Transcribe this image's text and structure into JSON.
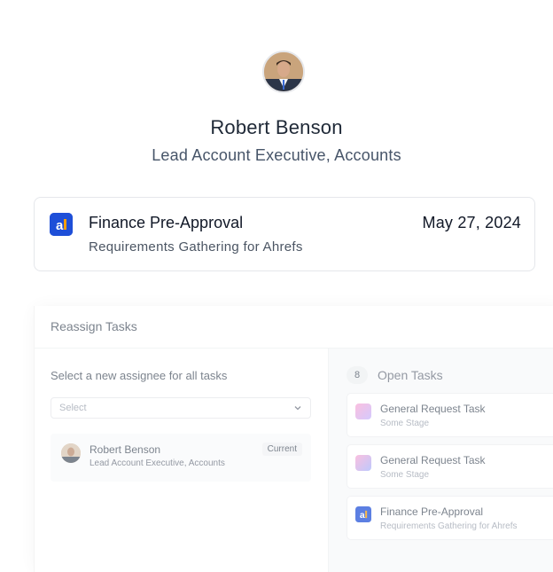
{
  "profile": {
    "name": "Robert Benson",
    "role": "Lead Account Executive, Accounts"
  },
  "deal": {
    "title": "Finance Pre-Approval",
    "subtitle": "Requirements Gathering for Ahrefs",
    "date": "May 27, 2024",
    "logo_letter": "a",
    "logo_color": "#1e4fd8"
  },
  "reassign": {
    "title": "Reassign Tasks",
    "select_label": "Select a new assignee for all tasks",
    "select_placeholder": "Select",
    "current_assignee": {
      "name": "Robert Benson",
      "role": "Lead Account Executive, Accounts",
      "badge": "Current"
    },
    "open_tasks_count": "8",
    "open_tasks_label": "Open Tasks",
    "tasks": [
      {
        "title": "General Request Task",
        "subtitle": "Some Stage",
        "icon": "gradient-task-icon"
      },
      {
        "title": "General Request Task",
        "subtitle": "Some Stage",
        "icon": "gradient-task-icon"
      },
      {
        "title": "Finance Pre-Approval",
        "subtitle": "Requirements Gathering for Ahrefs",
        "icon": "ahrefs-logo-icon"
      }
    ]
  },
  "colors": {
    "accent": "#1e4fd8",
    "logo_orange": "#f59e0b"
  }
}
